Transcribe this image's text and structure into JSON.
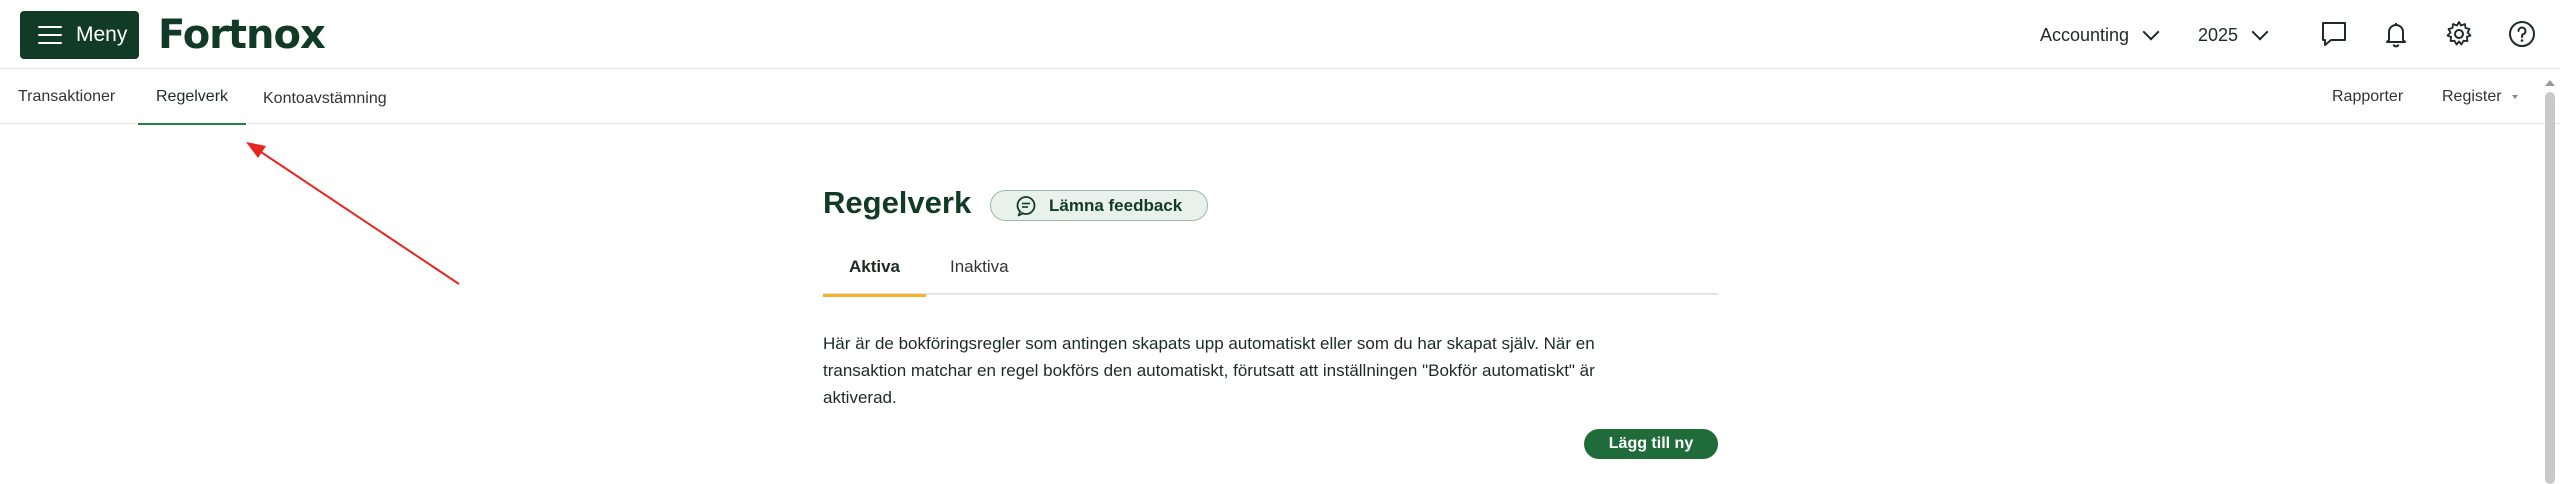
{
  "header": {
    "menu_label": "Meny",
    "logo_text": "Fortnox",
    "module_select": "Accounting",
    "year_select": "2025",
    "icons": [
      "chat-icon",
      "bell-icon",
      "gear-icon",
      "help-icon"
    ]
  },
  "subnav": {
    "items": [
      {
        "label": "Transaktioner",
        "active": false
      },
      {
        "label": "Regelverk",
        "active": true
      },
      {
        "label": "Kontoavstämning",
        "active": false
      }
    ],
    "right_items": [
      {
        "label": "Rapporter"
      },
      {
        "label": "Register"
      }
    ]
  },
  "main": {
    "title": "Regelverk",
    "feedback_label": "Lämna feedback",
    "tabs": [
      {
        "label": "Aktiva",
        "active": true
      },
      {
        "label": "Inaktiva",
        "active": false
      }
    ],
    "description_line1": "Här är de bokföringsregler som antingen skapats upp automatiskt eller som du har skapat själv. När en",
    "description_line2": "transaktion matchar en regel bokförs den automatiskt, förutsatt att inställningen \"Bokför automatiskt\" är",
    "description_line3": "aktiverad.",
    "add_button": "Lägg till ny"
  },
  "colors": {
    "brand_dark": "#123b27",
    "brand_green": "#1f6b3a",
    "active_tab_underline": "#f0b42d",
    "annotation_arrow": "#e8251f"
  }
}
